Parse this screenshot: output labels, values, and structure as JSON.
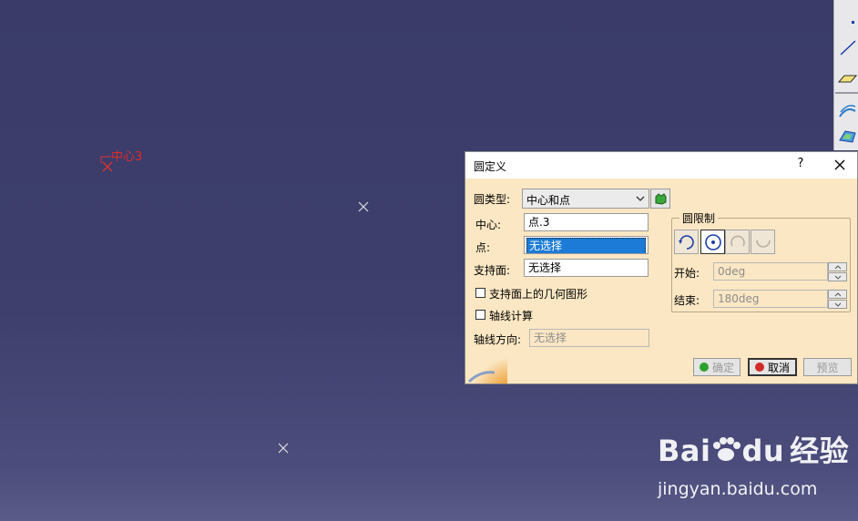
{
  "viewport": {
    "center_label": "中心3",
    "colors": {
      "background": "#3d3e6c",
      "point_mark": "#e0e0e0",
      "selected_mark": "#e03030"
    }
  },
  "toolbar": {
    "icons": [
      "point-icon",
      "line-icon",
      "plane-icon",
      "sweep-surface-icon",
      "multi-section-surface-icon"
    ]
  },
  "dialog": {
    "title": "圆定义",
    "help": "?",
    "circle_type_label": "圆类型:",
    "circle_type_value": "中心和点",
    "center_label": "中心:",
    "center_value": "点.3",
    "point_label": "点:",
    "point_value": "无选择",
    "support_label": "支持面:",
    "support_value": "无选择",
    "geometry_on_support_label": "支持面上的几何图形",
    "geometry_on_support_checked": false,
    "axis_compute_label": "轴线计算",
    "axis_compute_checked": false,
    "axis_direction_label": "轴线方向:",
    "axis_direction_placeholder": "无选择",
    "limits": {
      "title": "圆限制",
      "start_label": "开始:",
      "start_value": "0deg",
      "end_label": "结束:",
      "end_value": "180deg",
      "modes": [
        "part-arc-icon",
        "whole-circle-icon",
        "trimmed-circle-icon",
        "complementary-circle-icon"
      ],
      "active_mode": "whole-circle-icon"
    },
    "ok_label": "确定",
    "cancel_label": "取消",
    "preview_label": "预览",
    "colors": {
      "background": "#fbe7c4",
      "selection": "#1b7bd6",
      "ok_dot": "#2ea02e",
      "cancel_dot": "#d22a2a"
    }
  },
  "watermark": {
    "brand_bai": "Bai",
    "brand_du": "du",
    "brand_jingyan": "经验",
    "url": "jingyan.baidu.com"
  }
}
